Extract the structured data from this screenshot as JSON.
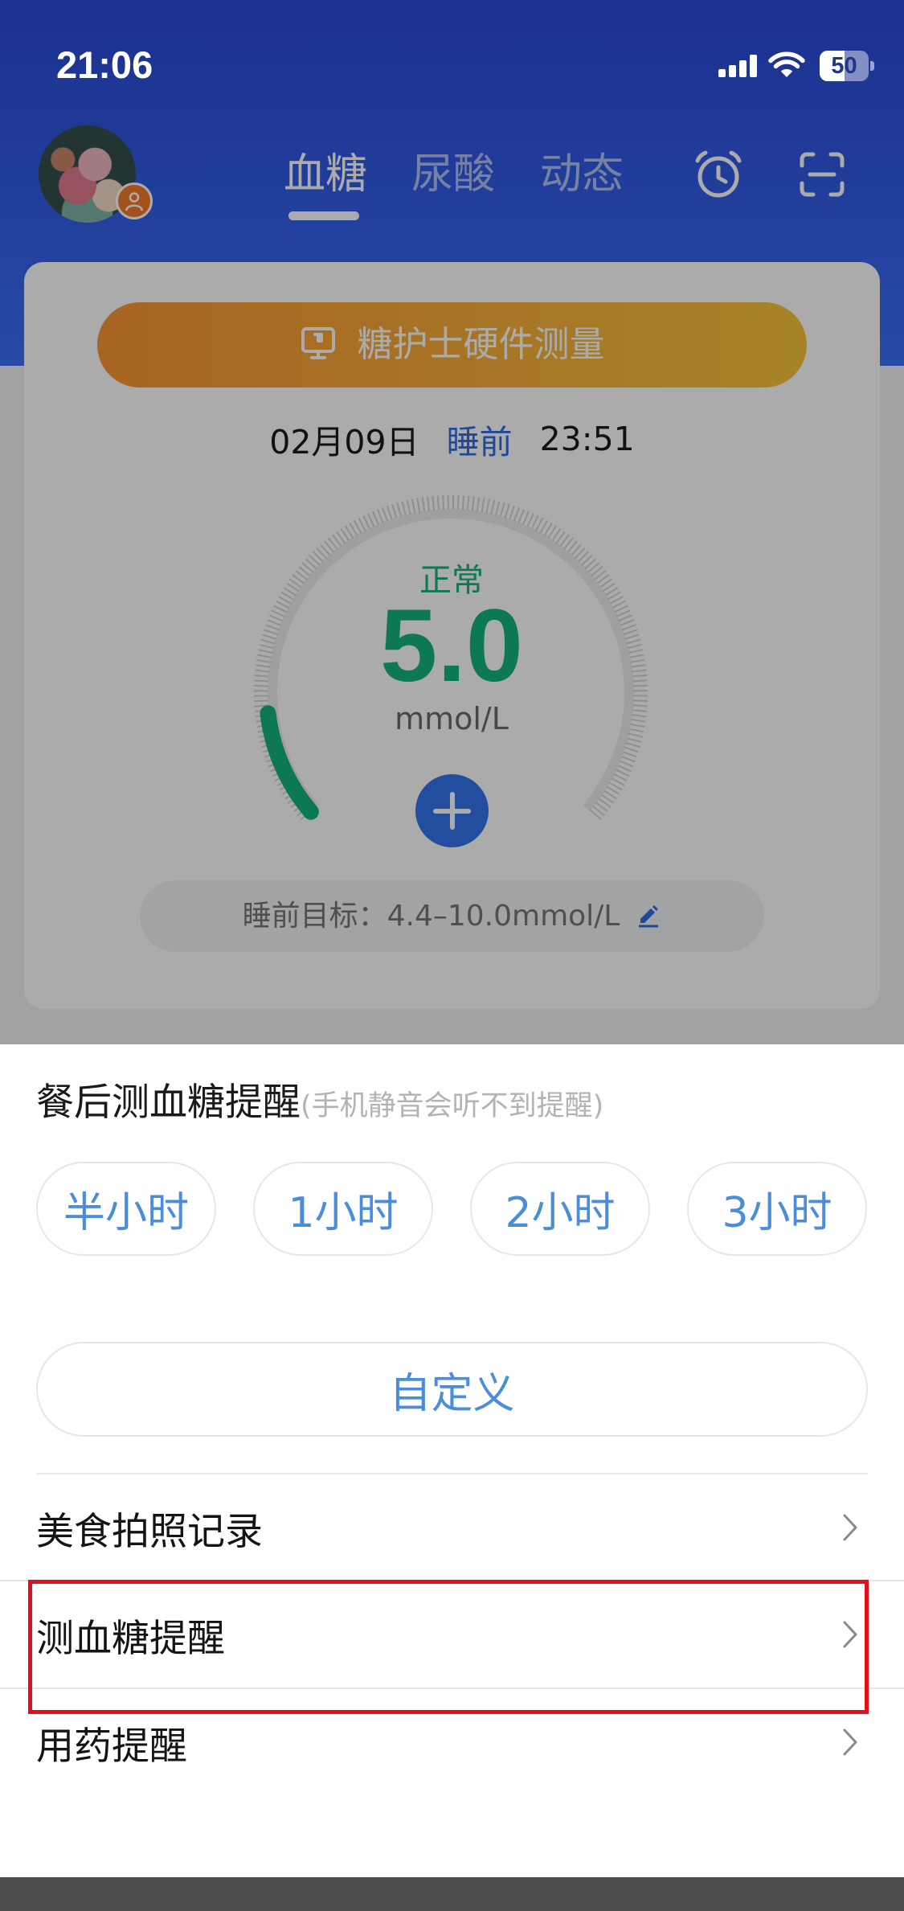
{
  "status_bar": {
    "time": "21:06",
    "battery_percent": "50",
    "battery_level": 0.5,
    "icons": [
      "signal-icon",
      "wifi-icon",
      "battery-icon"
    ]
  },
  "header": {
    "tabs": [
      {
        "label": "血糖",
        "selected": true
      },
      {
        "label": "尿酸",
        "selected": false
      },
      {
        "label": "动态",
        "selected": false
      }
    ],
    "actions": [
      "alarm-clock-icon",
      "scan-icon"
    ]
  },
  "card": {
    "hardware_button": {
      "label": "糖护士硬件测量",
      "icon": "monitor-icon"
    },
    "reading": {
      "date": "02月09日",
      "period": "睡前",
      "time": "23:51"
    },
    "gauge": {
      "status": "正常",
      "value": "5.0",
      "unit": "mmol/L",
      "fill_fraction": 0.13
    },
    "add_button_icon": "plus-icon",
    "target": {
      "text": "睡前目标：4.4–10.0mmol/L",
      "icon": "edit-icon"
    }
  },
  "sheet": {
    "title": "餐后测血糖提醒",
    "hint": "(手机静音会听不到提醒)",
    "options": [
      "半小时",
      "1小时",
      "2小时",
      "3小时"
    ],
    "custom_label": "自定义",
    "menu": [
      {
        "label": "美食拍照记录",
        "highlighted": false
      },
      {
        "label": "测血糖提醒",
        "highlighted": true
      },
      {
        "label": "用药提醒",
        "highlighted": false
      }
    ],
    "chevron_icon": "chevron-right-icon"
  },
  "colors": {
    "header_blue_top": "#2948d6",
    "header_blue_bottom": "#3a6ff7",
    "normal_green": "#12b47f",
    "accent_blue": "#3574ee",
    "period_blue": "#2f6ce0",
    "option_blue": "#4a8ddb",
    "button_orange": "#fb9634",
    "button_yellow": "#f9c43d",
    "highlight_red": "#e3101b"
  }
}
